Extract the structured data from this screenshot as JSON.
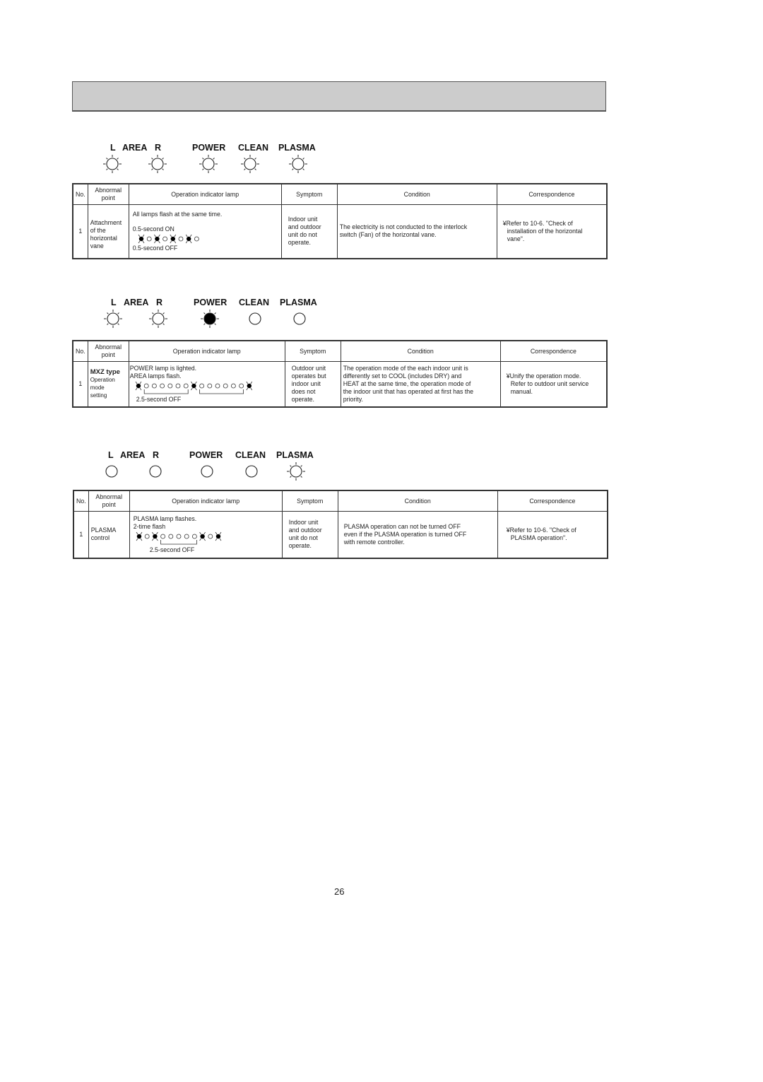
{
  "page": {
    "title_bar_text": "",
    "page_number": "26"
  },
  "lamp_labels": {
    "l": "L",
    "area": "AREA",
    "r": "R",
    "power": "POWER",
    "clean": "CLEAN",
    "plasma": "PLASMA"
  },
  "table_headers": {
    "no": "No.",
    "abnormal_point_1": "Abnormal",
    "abnormal_point_2": "point",
    "operation_indicator_lamp": "Operation indicator lamp",
    "symptom": "Symptom",
    "condition": "Condition",
    "correspondence": "Correspondence"
  },
  "sections": [
    {
      "lamp_states": {
        "l": "flashing",
        "r": "flashing",
        "power": "flashing",
        "clean": "flashing",
        "plasma": "flashing"
      },
      "row": {
        "no": "1",
        "abnormal_point": [
          "Attachment",
          "of the",
          "horizontal",
          "vane"
        ],
        "lamp_lines": [
          "All lamps flash at the same time.",
          "0.5-second ON",
          "0.5-second OFF"
        ],
        "sequence": [
          "on",
          "off",
          "on",
          "off",
          "on",
          "off",
          "on",
          "off"
        ],
        "symptom": [
          "Indoor unit",
          "and outdoor",
          "unit do not",
          "operate."
        ],
        "condition": [
          "The electricity is not conducted to the interlock",
          "switch (Fan) of the horizontal vane."
        ],
        "correspondence": [
          "¥Refer to 10-6.    \"Check of",
          "installation of the horizontal",
          "vane\"."
        ]
      }
    },
    {
      "lamp_states": {
        "l": "flashing",
        "r": "flashing",
        "power": "lit",
        "clean": "off",
        "plasma": "off"
      },
      "row": {
        "no": "1",
        "abnormal_point_bold": "MXZ type",
        "abnormal_point": [
          "Operation",
          "mode",
          "setting"
        ],
        "lamp_lines": [
          "POWER lamp is lighted.",
          "AREA lamps flash.",
          "2.5-second OFF"
        ],
        "sequence": [
          "on",
          "off",
          "off",
          "off",
          "off",
          "off",
          "off",
          "on",
          "off",
          "off",
          "off",
          "off",
          "off",
          "off",
          "on"
        ],
        "symptom": [
          "Outdoor unit",
          "operates but",
          "indoor unit",
          "does not",
          "operate."
        ],
        "condition": [
          "The operation mode of the each indoor unit is",
          "differently set to COOL (includes DRY) and",
          "HEAT at the same time, the operation mode of",
          "the indoor unit that has operated at first has the",
          "priority."
        ],
        "correspondence": [
          "¥Unify the operation mode.",
          "Refer to outdoor unit service",
          "manual."
        ]
      }
    },
    {
      "lamp_states": {
        "l": "off",
        "r": "off",
        "power": "off",
        "clean": "off",
        "plasma": "flashing"
      },
      "row": {
        "no": "1",
        "abnormal_point": [
          "PLASMA",
          "control"
        ],
        "lamp_lines": [
          "PLASMA lamp flashes.",
          "2-time flash",
          "2.5-second OFF"
        ],
        "sequence": [
          "on",
          "off",
          "on",
          "off",
          "off",
          "off",
          "off",
          "off",
          "on",
          "off",
          "on"
        ],
        "symptom": [
          "Indoor unit",
          "and outdoor",
          "unit do not",
          "operate."
        ],
        "condition": [
          "PLASMA operation  can not be turned OFF",
          "even if the PLASMA operation is turned OFF",
          "with remote controller."
        ],
        "correspondence": [
          "¥Refer to 10-6.    \"Check of",
          "PLASMA operation\"."
        ]
      }
    }
  ]
}
